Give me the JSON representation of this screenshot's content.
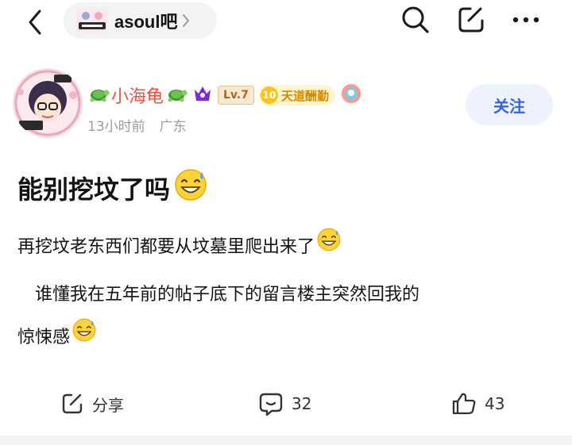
{
  "topbar": {
    "forum_name": "asoul吧",
    "icons": [
      "back-arrow-icon",
      "chevron-right-icon",
      "search-icon",
      "edit-icon",
      "more-icon"
    ]
  },
  "author": {
    "name": "小海龟",
    "level": "Lv.7",
    "title_number": "10",
    "title": "天道酬勤",
    "time": "13小时前",
    "location": "广东",
    "follow_label": "关注"
  },
  "post": {
    "title": "能别挖坟了吗",
    "paragraph1": "再挖坟老东西们都要从坟墓里爬出来了",
    "paragraph2_line1": "　谁懂我在五年前的帖子底下的留言楼主突然回我的",
    "paragraph2_line2": "惊悚感"
  },
  "actions": {
    "share_label": "分享",
    "comment_count": "32",
    "like_count": "43"
  },
  "colors": {
    "accent": "#3560f0",
    "username": "#f0503c",
    "meta": "#9c9c9c"
  }
}
